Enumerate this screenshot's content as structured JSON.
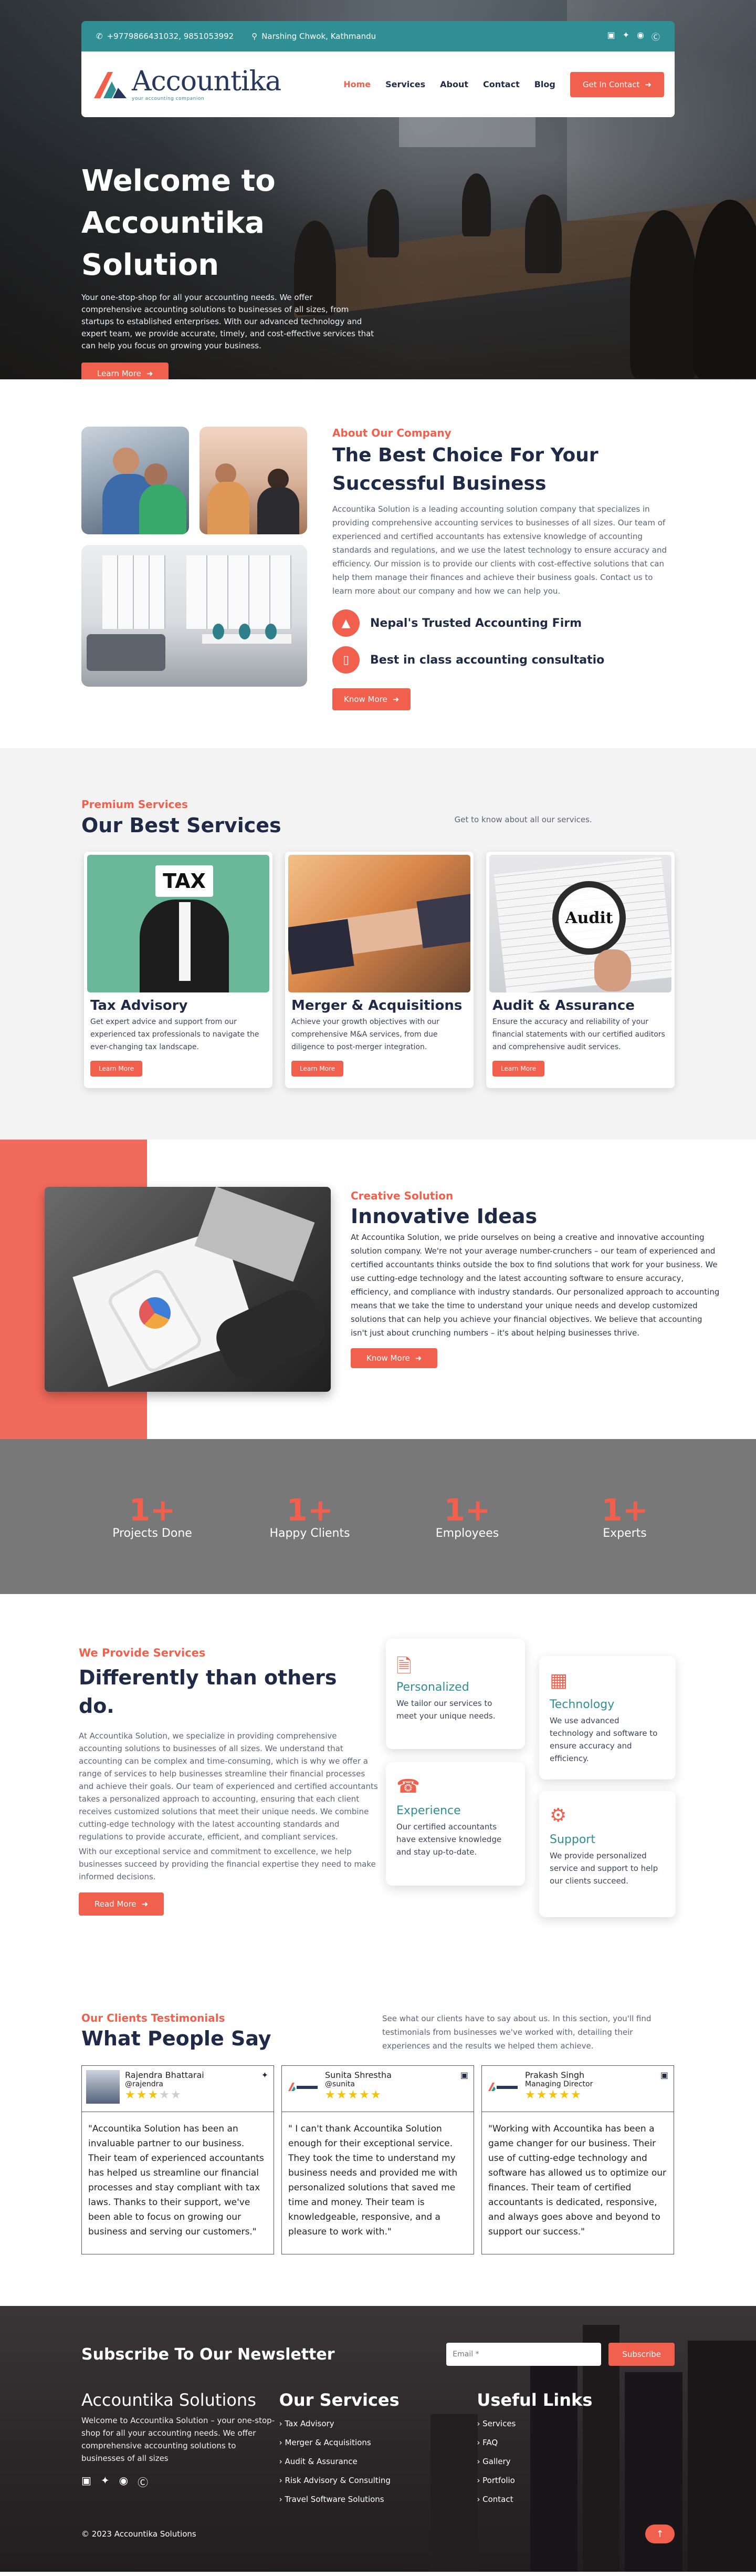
{
  "topbar": {
    "phone": "+9779866431032, 9851053992",
    "location": "Narshing Chwok, Kathmandu",
    "social_icons": [
      "facebook-icon",
      "twitter-icon",
      "instagram-icon",
      "skype-icon"
    ]
  },
  "brand": {
    "name": "Accountika",
    "tagline": "your accounting companion"
  },
  "nav": {
    "items": [
      "Home",
      "Services",
      "About",
      "Contact",
      "Blog"
    ],
    "active": "Home",
    "cta": "Get In Contact"
  },
  "hero": {
    "title_line1": "Welcome to",
    "title_line2": "Accountika Solution",
    "description": "Your one-stop-shop for all your accounting needs. We offer comprehensive accounting solutions to businesses of all sizes, from startups to established enterprises. With our advanced technology and expert team, we provide accurate, timely, and cost-effective services that can help you focus on growing your business.",
    "button": "Learn More"
  },
  "about": {
    "eyebrow": "About Our Company",
    "title": "The Best Choice For Your Successful Business",
    "body": "Accountika Solution is a leading accounting solution company that specializes in providing comprehensive accounting services to businesses of all sizes. Our team of experienced and certified accountants has extensive knowledge of accounting standards and regulations, and we use the latest technology to ensure accuracy and efficiency. Our mission is to provide our clients with cost-effective solutions that can help them manage their finances and achieve their business goals. Contact us to learn more about our company and how we can help you.",
    "features": [
      "Nepal's Trusted Accounting Firm",
      "Best in class accounting consultatio"
    ],
    "button": "Know More"
  },
  "services": {
    "eyebrow": "Premium Services",
    "title": "Our Best Services",
    "subtitle": "Get to know about all our services.",
    "cards": [
      {
        "title": "Tax Advisory",
        "desc": "Get expert advice and support from our experienced tax professionals to navigate the ever-changing tax landscape.",
        "button": "Learn More",
        "img_text": "TAX"
      },
      {
        "title": "Merger & Acquisitions",
        "desc": "Achieve your growth objectives with our comprehensive M&A services, from due diligence to post-merger integration.",
        "button": "Learn More",
        "img_text": ""
      },
      {
        "title": "Audit & Assurance",
        "desc": "Ensure the accuracy and reliability of your financial statements with our certified auditors and comprehensive audit services.",
        "button": "Learn More",
        "img_text": "Audit"
      }
    ]
  },
  "innovative": {
    "eyebrow": "Creative Solution",
    "title": "Innovative Ideas",
    "body": "At Accountika Solution, we pride ourselves on being a creative and innovative accounting solution company. We're not your average number-crunchers – our team of experienced and certified accountants thinks outside the box to find solutions that work for your business. We use cutting-edge technology and the latest accounting software to ensure accuracy, efficiency, and compliance with industry standards. Our personalized approach to accounting means that we take the time to understand your unique needs and develop customized solutions that can help you achieve your financial objectives. We believe that accounting isn't just about crunching numbers – it's about helping businesses thrive.",
    "button": "Know More"
  },
  "stats": [
    {
      "value": "1+",
      "label": "Projects Done"
    },
    {
      "value": "1+",
      "label": "Happy Clients"
    },
    {
      "value": "1+",
      "label": "Employees"
    },
    {
      "value": "1+",
      "label": "Experts"
    }
  ],
  "different": {
    "eyebrow": "We Provide Services",
    "title": "Differently than others do.",
    "body1": "At Accountika Solution, we specialize in providing comprehensive accounting solutions to businesses of all sizes. We understand that accounting can be complex and time-consuming, which is why we offer a range of services to help businesses streamline their financial processes and achieve their goals. Our team of experienced and certified accountants takes a personalized approach to accounting, ensuring that each client receives customized solutions that meet their unique needs. We combine cutting-edge technology with the latest accounting standards and regulations to provide accurate, efficient, and compliant services.",
    "body2": "With our exceptional service and commitment to excellence, we help businesses succeed by providing the financial expertise they need to make informed decisions.",
    "button": "Read More",
    "features": [
      {
        "title": "Personalized",
        "desc": "We tailor our services to meet your unique needs.",
        "icon": "document-icon"
      },
      {
        "title": "Technology",
        "desc": "We use advanced technology and software to ensure accuracy and efficiency.",
        "icon": "building-icon"
      },
      {
        "title": "Experience",
        "desc": "Our certified accountants have extensive knowledge and stay up-to-date.",
        "icon": "headset-icon"
      },
      {
        "title": "Support",
        "desc": "We provide personalized service and support to help our clients succeed.",
        "icon": "users-cog-icon"
      }
    ]
  },
  "testimonials": {
    "eyebrow": "Our Clients Testimonials",
    "title": "What People Say",
    "description": "See what our clients have to say about us. In this section, you'll find testimonials from businesses we've worked with, detailing their experiences and the results we helped them achieve.",
    "items": [
      {
        "name": "Rajendra Bhattarai",
        "handle": "@rajendra",
        "rating": 3,
        "source_icon": "twitter-icon",
        "quote": "\"Accountika Solution has been an invaluable partner to our business. Their team of experienced accountants has helped us streamline our financial processes and stay compliant with tax laws. Thanks to their support, we've been able to focus on growing our business and serving our customers.\""
      },
      {
        "name": "Sunita Shrestha",
        "handle": "@sunita",
        "rating": 5,
        "source_icon": "facebook-icon",
        "quote": "\" I can't thank Accountika Solution enough for their exceptional service. They took the time to understand my business needs and provided me with personalized solutions that saved me time and money. Their team is knowledgeable, responsive, and a pleasure to work with.\""
      },
      {
        "name": "Prakash Singh",
        "handle": "Managing Director",
        "rating": 5,
        "source_icon": "facebook-icon",
        "quote": "\"Working with Accountika has been a game changer for our business. Their use of cutting-edge technology and software has allowed us to optimize our finances. Their team of certified accountants is dedicated, responsive, and always goes above and beyond to support our success.\""
      }
    ]
  },
  "footer": {
    "newsletter_title": "Subscribe To Our Newsletter",
    "email_placeholder": "Email *",
    "subscribe": "Subscribe",
    "about_title": "Accountika Solutions",
    "about_text": "Welcome to Accountika Solution – your one-stop-shop for all your accounting needs. We offer comprehensive accounting solutions to businesses of all sizes",
    "services_title": "Our Services",
    "services": [
      "Tax Advisory",
      "Merger & Acquisitions",
      "Audit & Assurance",
      "Risk Advisory & Consulting",
      "Travel Software Solutions"
    ],
    "links_title": "Useful Links",
    "links": [
      "Services",
      "FAQ",
      "Gallery",
      "Portfolio",
      "Contact"
    ],
    "copyright": "© 2023 Accountika Solutions"
  },
  "colors": {
    "accent": "#f15f4d",
    "teal": "#2f8f94",
    "navy": "#1f2b46",
    "stats_bg": "#787878"
  }
}
